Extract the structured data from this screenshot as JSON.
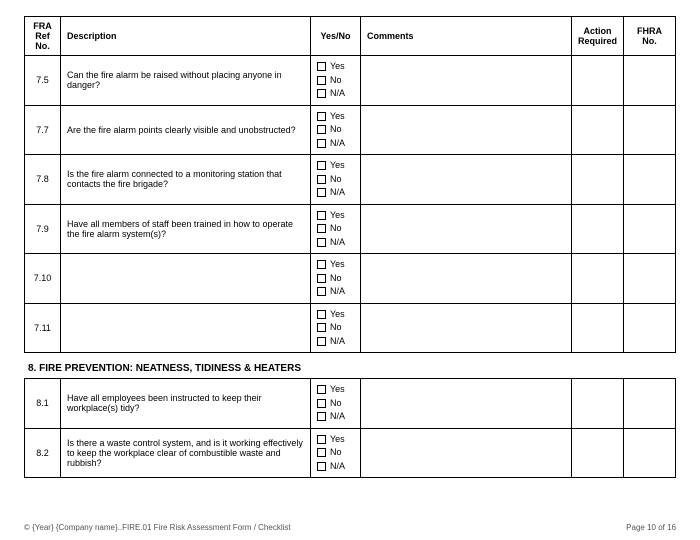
{
  "headers": {
    "ref": "FRA Ref No.",
    "desc": "Description",
    "yn": "Yes/No",
    "comments": "Comments",
    "action": "Action Required",
    "fhra": "FHRA No."
  },
  "yn_options": {
    "yes": "Yes",
    "no": "No",
    "na": "N/A"
  },
  "rows": [
    {
      "ref": "7.5",
      "desc": "Can the fire alarm be raised without placing anyone in danger?"
    },
    {
      "ref": "7.7",
      "desc": "Are the fire alarm points clearly visible and unobstructed?"
    },
    {
      "ref": "7.8",
      "desc": "Is the fire alarm connected to a monitoring station that contacts the fire brigade?"
    },
    {
      "ref": "7.9",
      "desc": "Have all members of staff been trained in how to operate the fire alarm system(s)?"
    },
    {
      "ref": "7.10",
      "desc": ""
    },
    {
      "ref": "7.11",
      "desc": ""
    }
  ],
  "section8": {
    "title": "8. FIRE PREVENTION: NEATNESS, TIDINESS & HEATERS",
    "rows": [
      {
        "ref": "8.1",
        "desc": "Have all employees been instructed to keep their workplace(s) tidy?"
      },
      {
        "ref": "8.2",
        "desc": "Is there a waste control system, and is it working effectively to keep the workplace clear of combustible waste and rubbish?"
      }
    ]
  },
  "footer": {
    "left": "© {Year} {Company name}..FIRE.01 Fire Risk Assessment Form / Checklist",
    "right": "Page 10 of 16"
  }
}
